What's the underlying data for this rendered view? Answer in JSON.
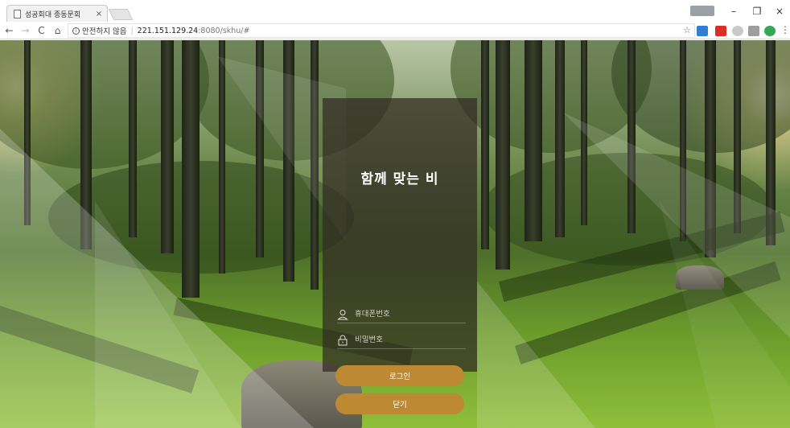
{
  "browser": {
    "tab": {
      "title": "성공회대 종동문회",
      "close": "×"
    },
    "window_controls": {
      "minimize": "–",
      "maximize": "❐",
      "close": "×"
    },
    "nav": {
      "back": "←",
      "forward": "→",
      "reload": "C",
      "home": "⌂"
    },
    "address": {
      "security_label": "안전하지 않음",
      "separator": "|",
      "url_host": "221.151.129.24",
      "url_rest": ":8080/skhu/#"
    },
    "bookmark_star": "☆",
    "menu": "⋮",
    "colors": {
      "ext_blue": "#2f7fd3",
      "ext_red": "#d93025",
      "ext_green": "#34a853"
    }
  },
  "login": {
    "title": "함께 맞는 비",
    "phone_placeholder": "휴대폰번호",
    "password_placeholder": "비밀번호",
    "login_button": "로그인",
    "close_button": "닫기",
    "colors": {
      "button": "#bd8a33",
      "panel": "rgba(48,42,34,0.72)"
    }
  }
}
